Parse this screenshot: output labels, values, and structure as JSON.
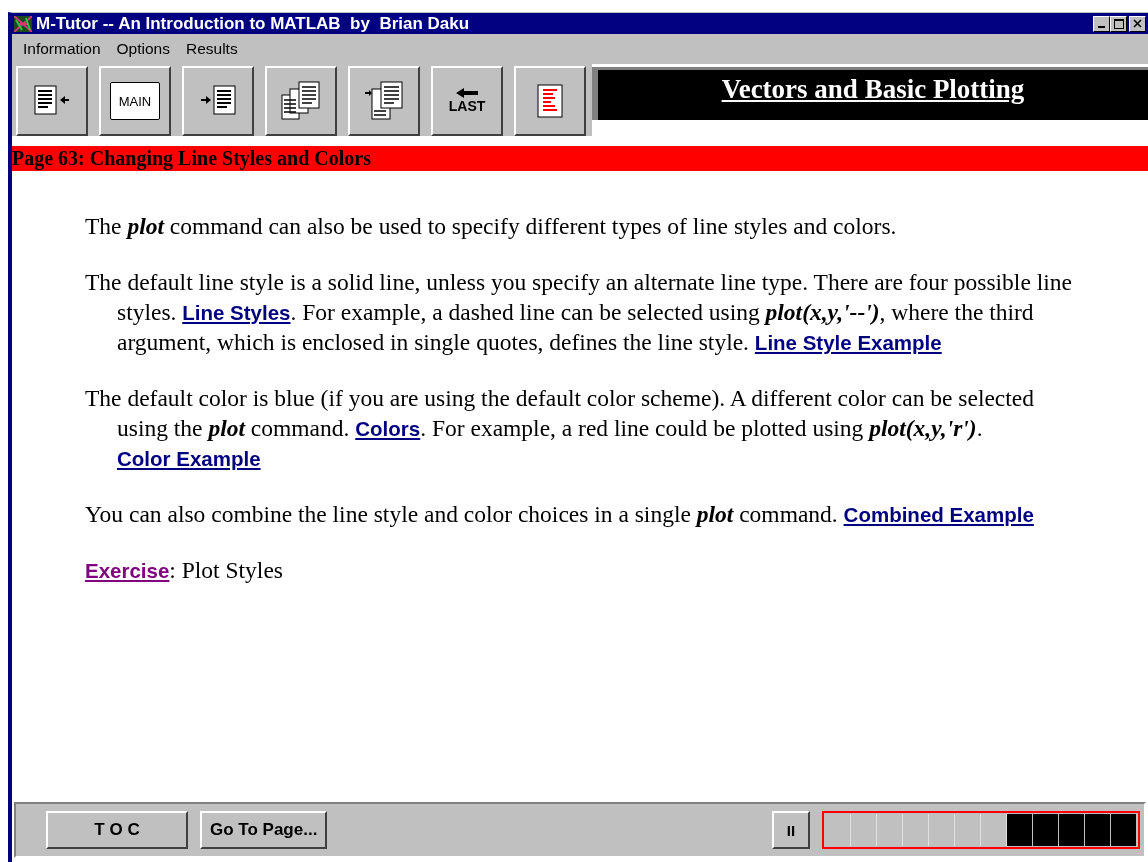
{
  "window": {
    "title": "M-Tutor -- An Introduction to MATLAB  by  Brian Daku"
  },
  "menu": [
    "Information",
    "Options",
    "Results"
  ],
  "toolbar": [
    {
      "kind": "page-back"
    },
    {
      "kind": "main",
      "label": "MAIN"
    },
    {
      "kind": "page-forward"
    },
    {
      "kind": "pages"
    },
    {
      "kind": "pages-forward"
    },
    {
      "kind": "last",
      "label": "LAST"
    },
    {
      "kind": "red-page"
    }
  ],
  "section_title": "Vectors and Basic Plotting",
  "page_header": "Page 63: Changing Line Styles and Colors",
  "paragraphs": [
    [
      {
        "kind": "text",
        "text": "The *plot* command can also be used to specify different types of line styles and colors."
      }
    ],
    [
      {
        "kind": "text",
        "text": "The default line style is a solid line, unless you specify an alternate line type.  There are four possible line styles.  "
      },
      {
        "kind": "link",
        "text": "Line Styles",
        "visited": false
      },
      {
        "kind": "text",
        "text": ".  For example, a dashed line can be selected using *plot(x,y,'--')*, where the third argument, which is enclosed in single quotes, defines the line style.  "
      },
      {
        "kind": "link",
        "text": "Line Style Example",
        "visited": false
      }
    ],
    [
      {
        "kind": "text",
        "text": "The default color is blue (if you are using the default color scheme).  A different color can be selected using the *plot* command.  "
      },
      {
        "kind": "link",
        "text": "Colors",
        "visited": false
      },
      {
        "kind": "text",
        "text": ".  For example, a red line could be plotted using *plot(x,y,'r')*.  "
      },
      {
        "kind": "link",
        "text": "Color Example",
        "visited": false
      }
    ],
    [
      {
        "kind": "text",
        "text": "You can also combine the line style and color choices in a single *plot* command.  "
      },
      {
        "kind": "link",
        "text": "Combined Example",
        "visited": false
      }
    ],
    [
      {
        "kind": "link",
        "text": "Exercise",
        "visited": true
      },
      {
        "kind": "text",
        "text": ": Plot Styles"
      }
    ]
  ],
  "bottom_bar": {
    "buttons": [
      "T O C",
      "Go To Page..."
    ],
    "pause": "II",
    "progress_cells": [
      {
        "filled": false
      },
      {
        "filled": false
      },
      {
        "filled": false
      },
      {
        "filled": false
      },
      {
        "filled": false
      },
      {
        "filled": false
      },
      {
        "filled": false
      },
      {
        "filled": true
      },
      {
        "filled": true
      },
      {
        "filled": true
      },
      {
        "filled": true
      },
      {
        "filled": true
      }
    ]
  }
}
